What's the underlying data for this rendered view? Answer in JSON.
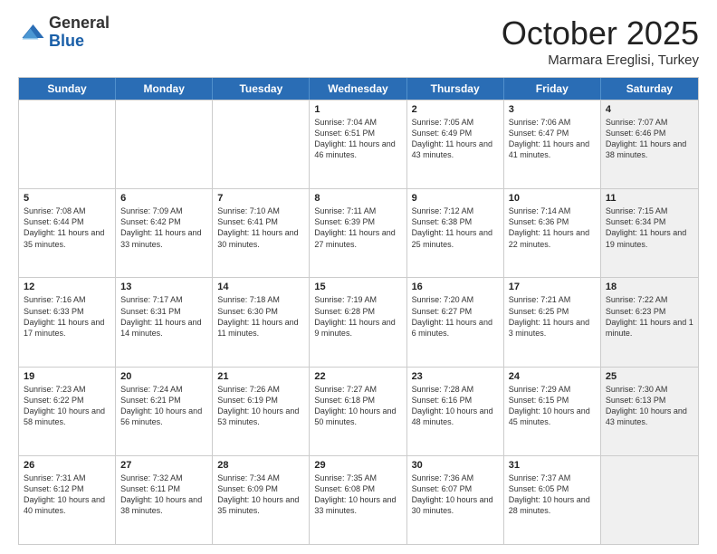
{
  "header": {
    "logo_line1": "General",
    "logo_line2": "Blue",
    "month": "October 2025",
    "location": "Marmara Ereglisi, Turkey"
  },
  "days_of_week": [
    "Sunday",
    "Monday",
    "Tuesday",
    "Wednesday",
    "Thursday",
    "Friday",
    "Saturday"
  ],
  "rows": [
    {
      "shaded_pattern": [
        false,
        false,
        false,
        false,
        false,
        false,
        true
      ],
      "cells": [
        {
          "day": "",
          "text": ""
        },
        {
          "day": "",
          "text": ""
        },
        {
          "day": "",
          "text": ""
        },
        {
          "day": "1",
          "text": "Sunrise: 7:04 AM\nSunset: 6:51 PM\nDaylight: 11 hours and 46 minutes."
        },
        {
          "day": "2",
          "text": "Sunrise: 7:05 AM\nSunset: 6:49 PM\nDaylight: 11 hours and 43 minutes."
        },
        {
          "day": "3",
          "text": "Sunrise: 7:06 AM\nSunset: 6:47 PM\nDaylight: 11 hours and 41 minutes."
        },
        {
          "day": "4",
          "text": "Sunrise: 7:07 AM\nSunset: 6:46 PM\nDaylight: 11 hours and 38 minutes."
        }
      ]
    },
    {
      "shaded_pattern": [
        false,
        false,
        false,
        false,
        false,
        false,
        true
      ],
      "cells": [
        {
          "day": "5",
          "text": "Sunrise: 7:08 AM\nSunset: 6:44 PM\nDaylight: 11 hours and 35 minutes."
        },
        {
          "day": "6",
          "text": "Sunrise: 7:09 AM\nSunset: 6:42 PM\nDaylight: 11 hours and 33 minutes."
        },
        {
          "day": "7",
          "text": "Sunrise: 7:10 AM\nSunset: 6:41 PM\nDaylight: 11 hours and 30 minutes."
        },
        {
          "day": "8",
          "text": "Sunrise: 7:11 AM\nSunset: 6:39 PM\nDaylight: 11 hours and 27 minutes."
        },
        {
          "day": "9",
          "text": "Sunrise: 7:12 AM\nSunset: 6:38 PM\nDaylight: 11 hours and 25 minutes."
        },
        {
          "day": "10",
          "text": "Sunrise: 7:14 AM\nSunset: 6:36 PM\nDaylight: 11 hours and 22 minutes."
        },
        {
          "day": "11",
          "text": "Sunrise: 7:15 AM\nSunset: 6:34 PM\nDaylight: 11 hours and 19 minutes."
        }
      ]
    },
    {
      "shaded_pattern": [
        false,
        false,
        false,
        false,
        false,
        false,
        true
      ],
      "cells": [
        {
          "day": "12",
          "text": "Sunrise: 7:16 AM\nSunset: 6:33 PM\nDaylight: 11 hours and 17 minutes."
        },
        {
          "day": "13",
          "text": "Sunrise: 7:17 AM\nSunset: 6:31 PM\nDaylight: 11 hours and 14 minutes."
        },
        {
          "day": "14",
          "text": "Sunrise: 7:18 AM\nSunset: 6:30 PM\nDaylight: 11 hours and 11 minutes."
        },
        {
          "day": "15",
          "text": "Sunrise: 7:19 AM\nSunset: 6:28 PM\nDaylight: 11 hours and 9 minutes."
        },
        {
          "day": "16",
          "text": "Sunrise: 7:20 AM\nSunset: 6:27 PM\nDaylight: 11 hours and 6 minutes."
        },
        {
          "day": "17",
          "text": "Sunrise: 7:21 AM\nSunset: 6:25 PM\nDaylight: 11 hours and 3 minutes."
        },
        {
          "day": "18",
          "text": "Sunrise: 7:22 AM\nSunset: 6:23 PM\nDaylight: 11 hours and 1 minute."
        }
      ]
    },
    {
      "shaded_pattern": [
        false,
        false,
        false,
        false,
        false,
        false,
        true
      ],
      "cells": [
        {
          "day": "19",
          "text": "Sunrise: 7:23 AM\nSunset: 6:22 PM\nDaylight: 10 hours and 58 minutes."
        },
        {
          "day": "20",
          "text": "Sunrise: 7:24 AM\nSunset: 6:21 PM\nDaylight: 10 hours and 56 minutes."
        },
        {
          "day": "21",
          "text": "Sunrise: 7:26 AM\nSunset: 6:19 PM\nDaylight: 10 hours and 53 minutes."
        },
        {
          "day": "22",
          "text": "Sunrise: 7:27 AM\nSunset: 6:18 PM\nDaylight: 10 hours and 50 minutes."
        },
        {
          "day": "23",
          "text": "Sunrise: 7:28 AM\nSunset: 6:16 PM\nDaylight: 10 hours and 48 minutes."
        },
        {
          "day": "24",
          "text": "Sunrise: 7:29 AM\nSunset: 6:15 PM\nDaylight: 10 hours and 45 minutes."
        },
        {
          "day": "25",
          "text": "Sunrise: 7:30 AM\nSunset: 6:13 PM\nDaylight: 10 hours and 43 minutes."
        }
      ]
    },
    {
      "shaded_pattern": [
        false,
        false,
        false,
        false,
        false,
        false,
        true
      ],
      "cells": [
        {
          "day": "26",
          "text": "Sunrise: 7:31 AM\nSunset: 6:12 PM\nDaylight: 10 hours and 40 minutes."
        },
        {
          "day": "27",
          "text": "Sunrise: 7:32 AM\nSunset: 6:11 PM\nDaylight: 10 hours and 38 minutes."
        },
        {
          "day": "28",
          "text": "Sunrise: 7:34 AM\nSunset: 6:09 PM\nDaylight: 10 hours and 35 minutes."
        },
        {
          "day": "29",
          "text": "Sunrise: 7:35 AM\nSunset: 6:08 PM\nDaylight: 10 hours and 33 minutes."
        },
        {
          "day": "30",
          "text": "Sunrise: 7:36 AM\nSunset: 6:07 PM\nDaylight: 10 hours and 30 minutes."
        },
        {
          "day": "31",
          "text": "Sunrise: 7:37 AM\nSunset: 6:05 PM\nDaylight: 10 hours and 28 minutes."
        },
        {
          "day": "",
          "text": ""
        }
      ]
    }
  ]
}
